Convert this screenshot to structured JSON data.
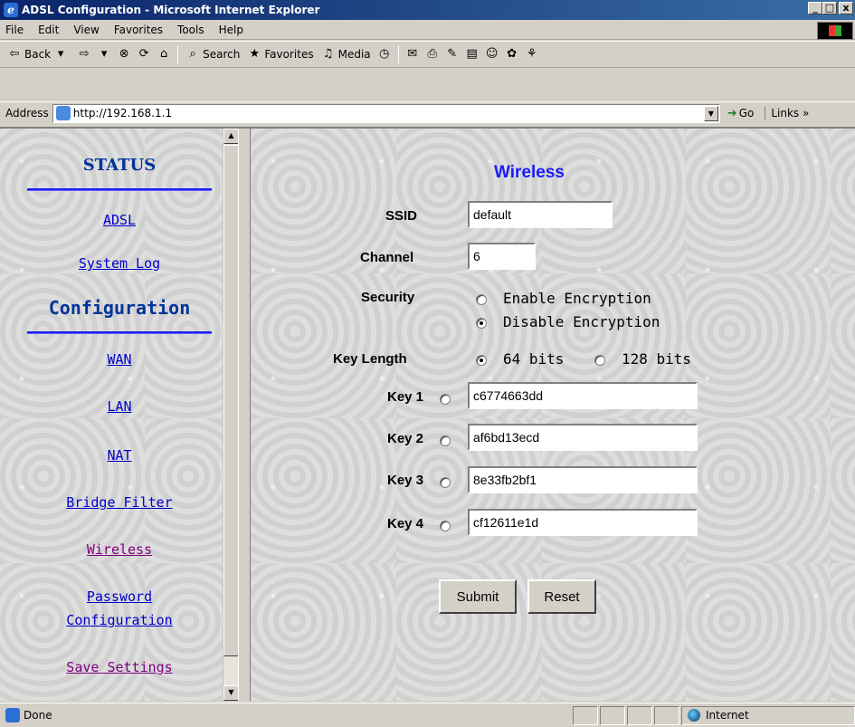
{
  "window": {
    "title": "ADSL Configuration - Microsoft Internet Explorer",
    "min": "_",
    "max": "□",
    "close": "x"
  },
  "menu": [
    "File",
    "Edit",
    "View",
    "Favorites",
    "Tools",
    "Help"
  ],
  "toolbar": {
    "back": "Back",
    "search": "Search",
    "favorites": "Favorites",
    "media": "Media"
  },
  "address": {
    "label": "Address",
    "url": "http://192.168.1.1",
    "go": "Go",
    "links": "Links »"
  },
  "nav": {
    "status_header": "STATUS",
    "adsl": "ADSL",
    "system_log": "System Log",
    "config_header": "Configuration",
    "wan": "WAN",
    "lan": "LAN",
    "nat": "NAT",
    "bridge_filter": "Bridge Filter",
    "wireless": "Wireless",
    "password1": "Password",
    "password2": "Configuration",
    "save_settings": "Save Settings"
  },
  "form": {
    "title": "Wireless",
    "ssid_label": "SSID",
    "ssid_value": "default",
    "channel_label": "Channel",
    "channel_value": "6",
    "security_label": "Security",
    "enable_encryption": "Enable Encryption",
    "disable_encryption": "Disable Encryption",
    "security_selected": "Disable Encryption",
    "key_length_label": "Key Length",
    "bits64": "64 bits",
    "bits128": "128 bits",
    "key_length_selected": "64 bits",
    "keys": [
      {
        "label": "Key 1",
        "value": "c6774663dd"
      },
      {
        "label": "Key 2",
        "value": "af6bd13ecd"
      },
      {
        "label": "Key 3",
        "value": "8e33fb2bf1"
      },
      {
        "label": "Key 4",
        "value": "cf12611e1d"
      }
    ],
    "submit": "Submit",
    "reset": "Reset"
  },
  "status": {
    "text": "Done",
    "zone": "Internet"
  }
}
